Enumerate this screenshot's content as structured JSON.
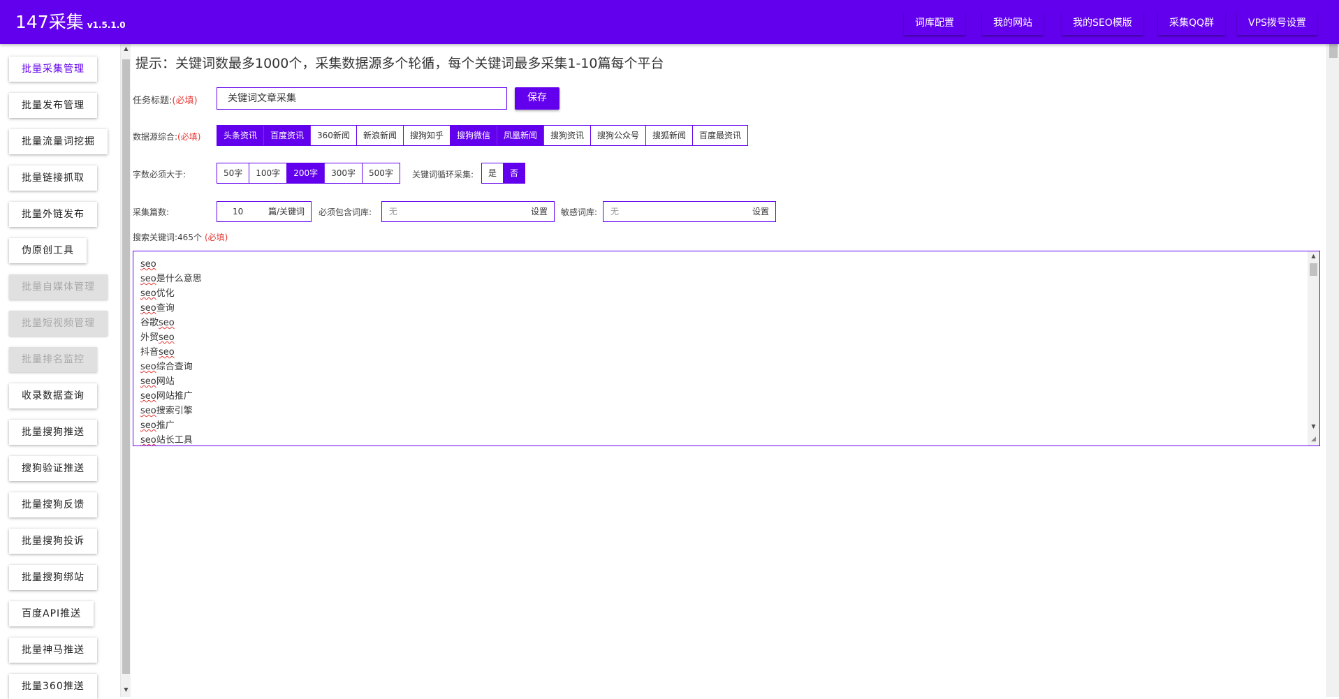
{
  "header": {
    "brand": "147采集",
    "version": "v1.5.1.0",
    "nav": [
      "词库配置",
      "我的网站",
      "我的SEO模版",
      "采集QQ群",
      "VPS拨号设置"
    ]
  },
  "sidebar": {
    "items": [
      {
        "label": "批量采集管理",
        "state": "active"
      },
      {
        "label": "批量发布管理",
        "state": "normal"
      },
      {
        "label": "批量流量词挖掘",
        "state": "normal"
      },
      {
        "label": "批量链接抓取",
        "state": "normal"
      },
      {
        "label": "批量外链发布",
        "state": "normal"
      },
      {
        "label": "伪原创工具",
        "state": "normal"
      },
      {
        "label": "批量自媒体管理",
        "state": "disabled"
      },
      {
        "label": "批量短视频管理",
        "state": "disabled"
      },
      {
        "label": "批量排名监控",
        "state": "disabled"
      },
      {
        "label": "收录数据查询",
        "state": "normal"
      },
      {
        "label": "批量搜狗推送",
        "state": "normal"
      },
      {
        "label": "搜狗验证推送",
        "state": "normal"
      },
      {
        "label": "批量搜狗反馈",
        "state": "normal"
      },
      {
        "label": "批量搜狗投诉",
        "state": "normal"
      },
      {
        "label": "批量搜狗绑站",
        "state": "normal"
      },
      {
        "label": "百度API推送",
        "state": "normal"
      },
      {
        "label": "批量神马推送",
        "state": "normal"
      },
      {
        "label": "批量360推送",
        "state": "normal"
      }
    ]
  },
  "main": {
    "tip": "提示：关键词数最多1000个，采集数据源多个轮循，每个关键词最多采集1-10篇每个平台",
    "task_title": {
      "label": "任务标题:",
      "required": "(必填)",
      "value": "关键词文章采集",
      "save": "保存"
    },
    "sources": {
      "label": "数据源综合:",
      "required": "(必填)",
      "options": [
        {
          "label": "头条资讯",
          "on": true
        },
        {
          "label": "百度资讯",
          "on": true
        },
        {
          "label": "360新闻",
          "on": false
        },
        {
          "label": "新浪新闻",
          "on": false
        },
        {
          "label": "搜狗知乎",
          "on": false
        },
        {
          "label": "搜狗微信",
          "on": true
        },
        {
          "label": "凤凰新闻",
          "on": true
        },
        {
          "label": "搜狗资讯",
          "on": false
        },
        {
          "label": "搜狗公众号",
          "on": false
        },
        {
          "label": "搜狐新闻",
          "on": false
        },
        {
          "label": "百度最资讯",
          "on": false
        }
      ]
    },
    "word_count": {
      "label": "字数必须大于:",
      "options": [
        {
          "label": "50字",
          "on": false
        },
        {
          "label": "100字",
          "on": false
        },
        {
          "label": "200字",
          "on": true
        },
        {
          "label": "300字",
          "on": false
        },
        {
          "label": "500字",
          "on": false
        }
      ]
    },
    "loop": {
      "label": "关键词循环采集:",
      "options": [
        {
          "label": "是",
          "on": false
        },
        {
          "label": "否",
          "on": true
        }
      ]
    },
    "count": {
      "label": "采集篇数:",
      "value": "10",
      "unit": "篇/关键词"
    },
    "must_include": {
      "label": "必须包含词库:",
      "value": "无",
      "action": "设置"
    },
    "sensitive": {
      "label": "敏感词库:",
      "value": "无",
      "action": "设置"
    },
    "keywords": {
      "label": "搜索关键词:465个",
      "required": "(必填)",
      "lines": [
        {
          "pre": "",
          "u": "seo",
          "post": ""
        },
        {
          "pre": "",
          "u": "seo",
          "post": "是什么意思"
        },
        {
          "pre": "",
          "u": "seo",
          "post": "优化"
        },
        {
          "pre": "",
          "u": "seo",
          "post": "查询"
        },
        {
          "pre": "谷歌",
          "u": "seo",
          "post": ""
        },
        {
          "pre": "外贸",
          "u": "seo",
          "post": ""
        },
        {
          "pre": "抖音",
          "u": "seo",
          "post": ""
        },
        {
          "pre": "",
          "u": "seo",
          "post": "综合查询"
        },
        {
          "pre": "",
          "u": "seo",
          "post": "网站"
        },
        {
          "pre": "",
          "u": "seo",
          "post": "网站推广"
        },
        {
          "pre": "",
          "u": "seo",
          "post": "搜索引擎"
        },
        {
          "pre": "",
          "u": "seo",
          "post": "推广"
        },
        {
          "pre": "",
          "u": "seo",
          "post": "站长工具"
        }
      ]
    }
  }
}
